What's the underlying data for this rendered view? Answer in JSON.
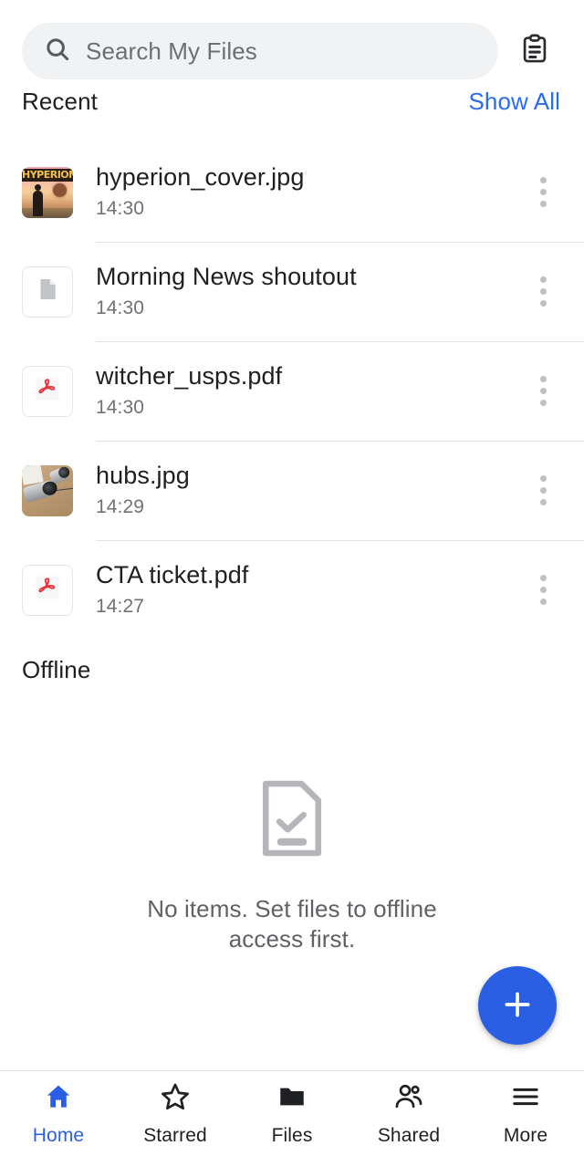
{
  "colors": {
    "accent_blue": "#2b5fe3",
    "link_blue": "#2b6bed",
    "search_bg": "#f1f2f4",
    "text_primary": "#1e1f21",
    "text_secondary": "#6f7176",
    "divider": "#e2e3e5",
    "kebab_dot": "#bfc0c3",
    "pdf_red": "#e8333a",
    "empty_icon_gray": "#b5b6b9"
  },
  "header": {
    "search": {
      "placeholder": "Search My Files",
      "value": "",
      "icon": "search-icon"
    },
    "clipboard_icon": "clipboard-icon"
  },
  "recent": {
    "title": "Recent",
    "show_all_label": "Show All",
    "files": [
      {
        "name": "hyperion_cover.jpg",
        "time": "14:30",
        "thumb_type": "image-hyperion",
        "thumb_title": "HYPERION",
        "menu_icon": "more-vertical-icon"
      },
      {
        "name": "Morning News shoutout",
        "time": "14:30",
        "thumb_type": "generic-document",
        "menu_icon": "more-vertical-icon"
      },
      {
        "name": "witcher_usps.pdf",
        "time": "14:30",
        "thumb_type": "pdf",
        "menu_icon": "more-vertical-icon"
      },
      {
        "name": "hubs.jpg",
        "time": "14:29",
        "thumb_type": "image-hubs",
        "menu_icon": "more-vertical-icon"
      },
      {
        "name": "CTA ticket.pdf",
        "time": "14:27",
        "thumb_type": "pdf",
        "menu_icon": "more-vertical-icon"
      }
    ]
  },
  "offline": {
    "title": "Offline",
    "empty_icon": "document-check-icon",
    "empty_message": "No items. Set files to offline access first."
  },
  "fab": {
    "label": "+",
    "icon": "plus-icon"
  },
  "bottom_nav": {
    "items": [
      {
        "label": "Home",
        "icon": "home-icon",
        "active": true
      },
      {
        "label": "Starred",
        "icon": "star-icon",
        "active": false
      },
      {
        "label": "Files",
        "icon": "folder-icon",
        "active": false
      },
      {
        "label": "Shared",
        "icon": "people-icon",
        "active": false
      },
      {
        "label": "More",
        "icon": "menu-icon",
        "active": false
      }
    ]
  }
}
